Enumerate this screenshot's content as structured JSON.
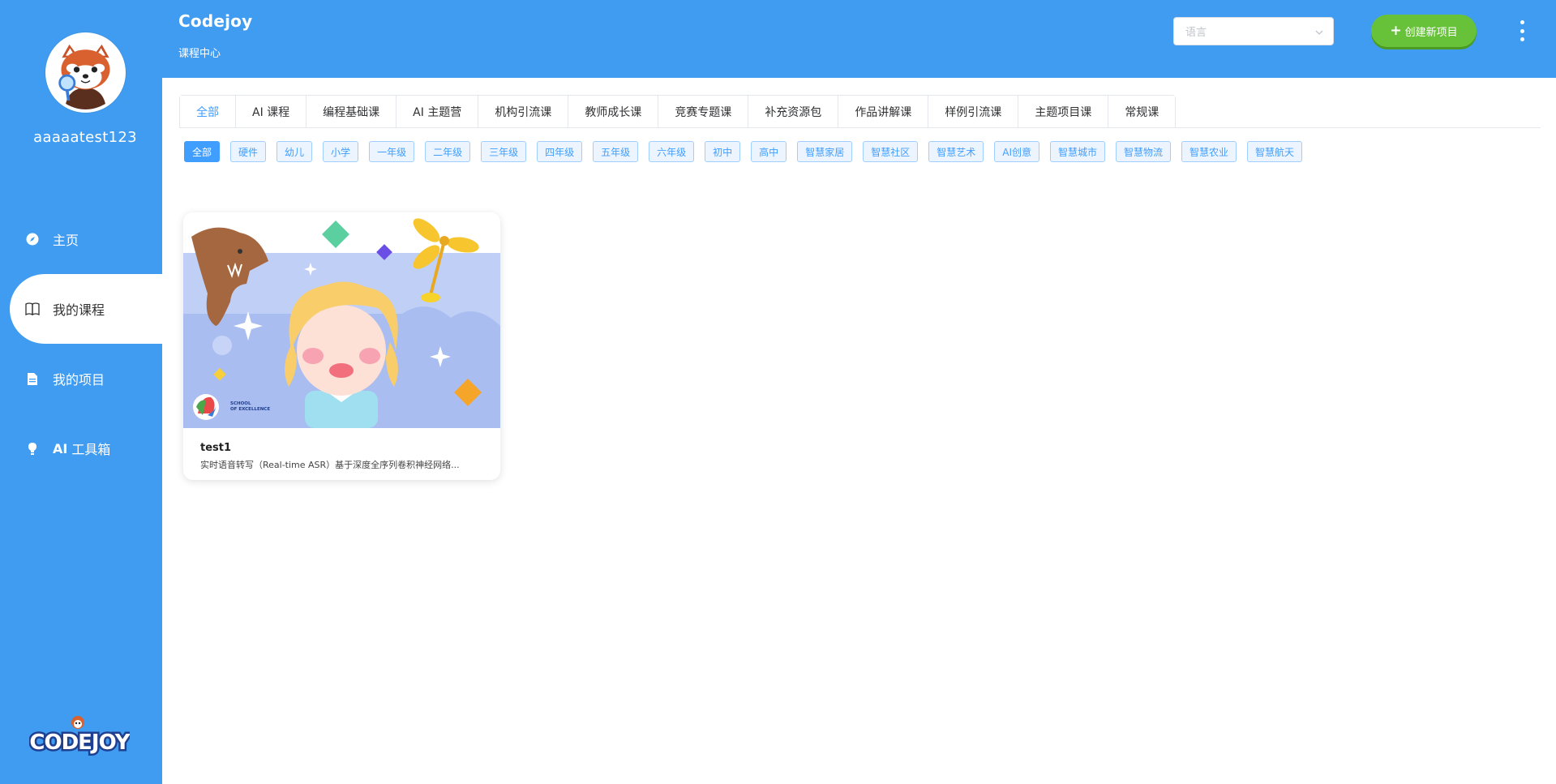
{
  "sidebar": {
    "username": "aaaaatest123",
    "nav": [
      {
        "label": "主页",
        "icon": "compass-icon"
      },
      {
        "label": "我的课程",
        "icon": "book-icon"
      },
      {
        "label": "我的项目",
        "icon": "document-icon"
      },
      {
        "prefix": "AI",
        "label": "工具箱",
        "icon": "lightbulb-icon"
      }
    ],
    "logo_text": "CODEJOY"
  },
  "header": {
    "brand": "Codejoy",
    "subtitle": "课程中心",
    "language_placeholder": "语言",
    "create_button": "创建新项目"
  },
  "tabs": [
    "全部",
    "AI 课程",
    "编程基础课",
    "AI 主题营",
    "机构引流课",
    "教师成长课",
    "竞赛专题课",
    "补充资源包",
    "作品讲解课",
    "样例引流课",
    "主题项目课",
    "常规课"
  ],
  "chips": [
    "全部",
    "硬件",
    "幼儿",
    "小学",
    "一年级",
    "二年级",
    "三年级",
    "四年级",
    "五年级",
    "六年级",
    "初中",
    "高中",
    "智慧家居",
    "智慧社区",
    "智慧艺术",
    "AI创意",
    "智慧城市",
    "智慧物流",
    "智慧农业",
    "智慧航天"
  ],
  "courses": [
    {
      "title": "test1",
      "description": "实时语音转写（Real-time ASR）基于深度全序列卷积神经网络...",
      "badge_line1": "SCHOOL",
      "badge_line2": "OF EXCELLENCE"
    }
  ],
  "colors": {
    "primary": "#409cf1",
    "accent": "#409eff",
    "create_green": "#67c23a"
  }
}
